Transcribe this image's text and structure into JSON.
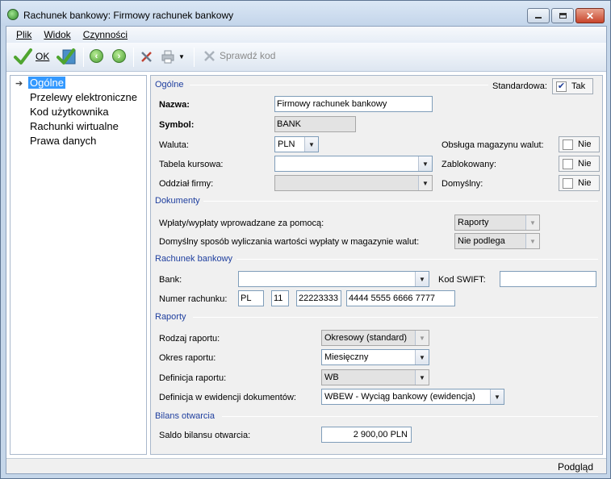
{
  "window": {
    "title": "Rachunek bankowy: Firmowy rachunek bankowy"
  },
  "menu": [
    "Plik",
    "Widok",
    "Czynności"
  ],
  "toolbar": {
    "ok_label": "OK",
    "check_code_label": "Sprawdź kod"
  },
  "tree": {
    "items": [
      "Ogólne",
      "Przelewy elektroniczne",
      "Kod użytkownika",
      "Rachunki wirtualne",
      "Prawa danych"
    ],
    "selected": 0
  },
  "general": {
    "section": "Ogólne",
    "standard_label": "Standardowa:",
    "standard_value": "Tak",
    "name_label": "Nazwa:",
    "name_value": "Firmowy rachunek bankowy",
    "symbol_label": "Symbol:",
    "symbol_value": "BANK",
    "currency_label": "Waluta:",
    "currency_value": "PLN",
    "rate_table_label": "Tabela kursowa:",
    "rate_table_value": "",
    "branch_label": "Oddział firmy:",
    "branch_value": "",
    "currency_store_label": "Obsługa magazynu walut:",
    "currency_store_value": "Nie",
    "blocked_label": "Zablokowany:",
    "blocked_value": "Nie",
    "default_label": "Domyślny:",
    "default_value": "Nie"
  },
  "documents": {
    "section": "Dokumenty",
    "payments_label": "Wpłaty/wypłaty wprowadzane za pomocą:",
    "payments_value": "Raporty",
    "calc_label": "Domyślny sposób wyliczania wartości wypłaty w magazynie walut:",
    "calc_value": "Nie podlega"
  },
  "account": {
    "section": "Rachunek bankowy",
    "bank_label": "Bank:",
    "bank_value": "",
    "swift_label": "Kod SWIFT:",
    "swift_value": "",
    "number_label": "Numer rachunku:",
    "number_country": "PL",
    "number_check": "11",
    "number_bank": "22223333",
    "number_rest": "4444 5555 6666 7777"
  },
  "reports": {
    "section": "Raporty",
    "type_label": "Rodzaj raportu:",
    "type_value": "Okresowy (standard)",
    "period_label": "Okres raportu:",
    "period_value": "Miesięczny",
    "def_label": "Definicja raportu:",
    "def_value": "WB",
    "doc_def_label": "Definicja w ewidencji dokumentów:",
    "doc_def_value": "WBEW - Wyciąg bankowy (ewidencja)"
  },
  "opening": {
    "section": "Bilans otwarcia",
    "balance_label": "Saldo bilansu otwarcia:",
    "balance_value": "2 900,00 PLN"
  },
  "status": {
    "label": "Podgląd"
  }
}
